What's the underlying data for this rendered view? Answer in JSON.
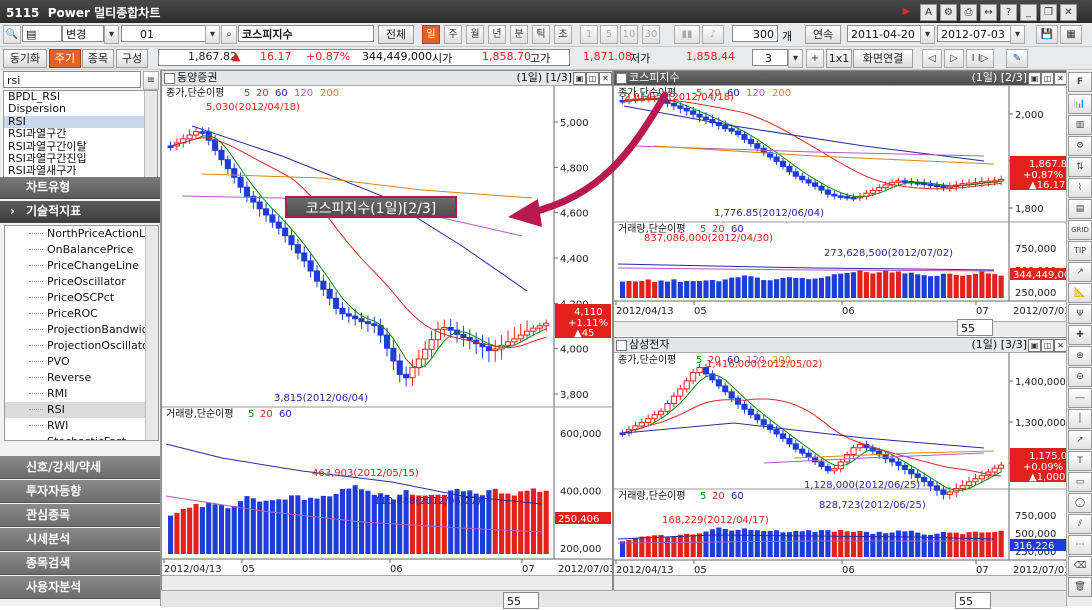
{
  "window": {
    "code": "5115",
    "title": "Power 멀티종합차트"
  },
  "toolbar1": {
    "change_label": "변경",
    "group_value": "01",
    "symbol_value": "코스피지수",
    "all_label": "전체",
    "periods": [
      "일",
      "주",
      "월",
      "년",
      "분",
      "틱",
      "초"
    ],
    "minutes": [
      "1",
      "5",
      "10",
      "30"
    ],
    "count_value": "300",
    "count_unit": "개",
    "continuous_label": "연속",
    "date_from": "2011-04-20",
    "date_to": "2012-07-03"
  },
  "toolbar2": {
    "sync_label": "동기화",
    "cycle_label": "주기",
    "stock_label": "종목",
    "compose_label": "구성",
    "price": "1,867.82",
    "change": "16.17",
    "change_pct": "+0.87%",
    "volume": "344,449,000",
    "open_label": "시가",
    "open_value": "1,858.70",
    "high_label": "고가",
    "high_value": "1,871.08",
    "low_label": "저가",
    "low_value": "1,858.44",
    "layout_value": "3",
    "grid_label": "1x1",
    "screen_link_label": "화면연결"
  },
  "left": {
    "search_value": "rsi",
    "indicator_list": [
      "BPDL_RSI",
      "Dispersion",
      "RSI",
      "RSI과열구간",
      "RSI과열구간이탈",
      "RSI과열구간진입",
      "RSI과열새구가"
    ],
    "selected_index": 2,
    "sections": {
      "chart_type": "차트유형",
      "tech_indicator": "기술적지표"
    },
    "tree_items": [
      "NorthPriceActionLine",
      "OnBalancePrice",
      "PriceChangeLine",
      "PriceOscillator",
      "PriceOSCPct",
      "PriceROC",
      "ProjectionBandwidth",
      "ProjectionOscillator",
      "PVO",
      "Reverse",
      "RMI",
      "RSI",
      "RWI",
      "StochasticFast"
    ],
    "tree_selected": 11,
    "nav_buttons": [
      "신호/강세/약세",
      "투자자동향",
      "관심종목",
      "시세분석",
      "종목검색",
      "사용자분석"
    ]
  },
  "panes": [
    {
      "title": "동양증권",
      "index": "(1일) [1/3]",
      "price_legend": {
        "name": "종가,단순이평",
        "periods": [
          "5",
          "20",
          "60",
          "120",
          "200"
        ]
      },
      "price_axis": [
        "5,000",
        "4,800",
        "4,600",
        "4,400",
        "4,200",
        "4,000",
        "3,800"
      ],
      "price_tag": {
        "value": "4,110",
        "pct": "+1.11%",
        "chg": "▲45"
      },
      "high_annot": "5,030(2012/04/18)",
      "low_annot": "3,815(2012/06/04)",
      "vol_legend": {
        "name": "거래량,단순이평",
        "periods": [
          "5",
          "20",
          "60"
        ]
      },
      "vol_axis": [
        "600,000",
        "400,000",
        "200,000"
      ],
      "vol_tag": "250,406",
      "vol_annots": [
        "463,903(2012/05/15)",
        "110,888(2012/06/27)"
      ],
      "x_labels": [
        "2012/04/13",
        "05",
        "06",
        "07"
      ],
      "x_end": "2012/07/03",
      "zoom": "55"
    },
    {
      "title": "코스피지수",
      "index": "(1일) [2/3]",
      "price_legend": {
        "name": "종가,단순이평",
        "periods": [
          "5",
          "20",
          "60",
          "120",
          "200"
        ]
      },
      "price_axis": [
        "2,000",
        "1,900",
        "1,800"
      ],
      "price_tag": {
        "value": "1,867.82",
        "pct": "+0.87%",
        "chg": "▲16.17"
      },
      "high_annot": "2,014.55(2012/04/18)",
      "low_annot": "1,776.85(2012/06/04)",
      "vol_legend": {
        "name": "거래량,단순이평",
        "periods": [
          "5",
          "20",
          "60"
        ]
      },
      "vol_axis": [
        "750,000",
        "500,000",
        "250,000"
      ],
      "vol_tag": "344,449,000",
      "vol_annots": [
        "837,086,000(2012/04/30)",
        "273,628,500(2012/07/02)"
      ],
      "x_labels": [
        "2012/04/13",
        "05",
        "06",
        "07"
      ],
      "x_end": "2012/07/03",
      "zoom": "55"
    },
    {
      "title": "삼성전자",
      "index": "(1일) [3/3]",
      "price_legend": {
        "name": "종가,단순이평",
        "periods": [
          "5",
          "20",
          "60",
          "120",
          "200"
        ]
      },
      "price_axis": [
        "1,400,000",
        "1,300,000",
        "1,200,000"
      ],
      "price_tag": {
        "value": "1,175,000",
        "pct": "+0.09%",
        "chg": "▲1,000"
      },
      "high_annot": "1,416,000(2012/05/02)",
      "low_annot": "1,128,000(2012/06/25)",
      "vol_legend": {
        "name": "거래량,단순이평",
        "periods": [
          "5",
          "20",
          "60"
        ]
      },
      "vol_axis": [
        "750,000",
        "500,000",
        "250,000"
      ],
      "vol_tag": "316,226",
      "vol_annots": [
        "168,229(2012/04/17)",
        "828,723(2012/06/25)"
      ],
      "x_labels": [
        "2012/04/13",
        "05",
        "06",
        "07"
      ],
      "x_end": "2012/07/03",
      "zoom": "55"
    }
  ],
  "callout": "코스피지수(1일)[2/3]",
  "right_tools": [
    "F",
    "GRID",
    "TIP"
  ],
  "colors": {
    "up": "#e2211c",
    "down": "#1d3cd8",
    "ma5": "#0a8a0a",
    "ma20": "#d62b2b",
    "ma60": "#2a2aa0",
    "ma120": "#b05cc0",
    "ma200": "#d28a10",
    "accent": "#e0622b",
    "callout": "#b8194e"
  }
}
